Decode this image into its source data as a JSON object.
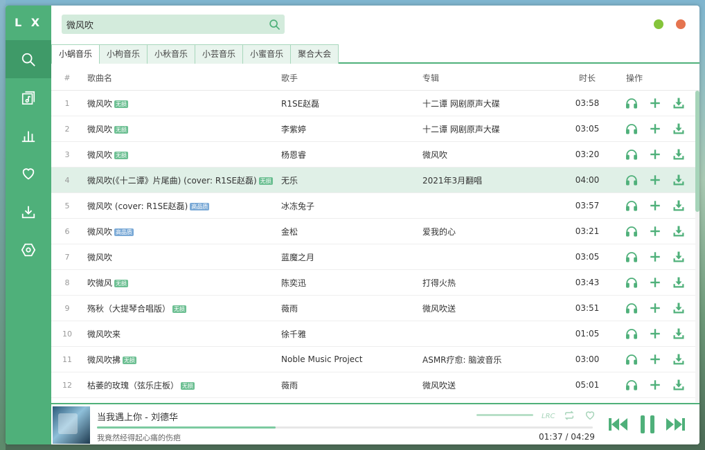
{
  "app": {
    "logo": "L X"
  },
  "search": {
    "value": "微风吹"
  },
  "tabs": [
    "小蜗音乐",
    "小枸音乐",
    "小秋音乐",
    "小芸音乐",
    "小蜜音乐",
    "聚合大会"
  ],
  "table": {
    "headers": {
      "num": "#",
      "name": "歌曲名",
      "artist": "歌手",
      "album": "专辑",
      "duration": "时长",
      "ops": "操作"
    },
    "rows": [
      {
        "num": "1",
        "name": "微风吹",
        "tag": "无损",
        "tag_type": "sq",
        "artist": "R1SE赵磊",
        "album": "十二谭 网剧原声大碟",
        "duration": "03:58"
      },
      {
        "num": "2",
        "name": "微风吹",
        "tag": "无损",
        "tag_type": "sq",
        "artist": "李紫婷",
        "album": "十二谭 网剧原声大碟",
        "duration": "03:05"
      },
      {
        "num": "3",
        "name": "微风吹",
        "tag": "无损",
        "tag_type": "sq",
        "artist": "杨恩睿",
        "album": "微风吹",
        "duration": "03:20"
      },
      {
        "num": "4",
        "name": "微风吹(《十二谭》片尾曲) (cover: R1SE赵磊)",
        "tag": "无损",
        "tag_type": "sq",
        "artist": "无乐",
        "album": "2021年3月翻唱",
        "duration": "04:00"
      },
      {
        "num": "5",
        "name": "微风吹 (cover: R1SE赵磊)",
        "tag": "高品质",
        "tag_type": "hq",
        "artist": "冰冻兔子",
        "album": "",
        "duration": "03:57"
      },
      {
        "num": "6",
        "name": "微风吹",
        "tag": "高品质",
        "tag_type": "hq",
        "artist": "金松",
        "album": "爱我的心",
        "duration": "03:21"
      },
      {
        "num": "7",
        "name": "微风吹",
        "tag": "",
        "tag_type": "",
        "artist": "蓝魔之月",
        "album": "",
        "duration": "03:05"
      },
      {
        "num": "8",
        "name": "吹微风",
        "tag": "无损",
        "tag_type": "sq",
        "artist": "陈奕迅",
        "album": "打得火热",
        "duration": "03:43"
      },
      {
        "num": "9",
        "name": "殇秋（大提琴合唱版）",
        "tag": "无损",
        "tag_type": "sq",
        "artist": "薇雨",
        "album": "微风吹送",
        "duration": "03:51"
      },
      {
        "num": "10",
        "name": "微风吹来",
        "tag": "",
        "tag_type": "",
        "artist": "徐千雅",
        "album": "",
        "duration": "01:05"
      },
      {
        "num": "11",
        "name": "微风吹拂",
        "tag": "无损",
        "tag_type": "sq",
        "artist": "Noble Music Project",
        "album": "ASMR疗愈: 脑波音乐",
        "duration": "03:00"
      },
      {
        "num": "12",
        "name": "枯萎的玫瑰（弦乐庄板）",
        "tag": "无损",
        "tag_type": "sq",
        "artist": "薇雨",
        "album": "微风吹送",
        "duration": "05:01"
      }
    ],
    "highlighted_row": 4,
    "row_icons": [
      "headphones-icon",
      "plus-icon",
      "download-icon"
    ]
  },
  "player": {
    "title": "当我遇上你 - 刘德华",
    "lyric": "我竟然经得起心痛的伤疤",
    "current_time": "01:37",
    "separator": "/",
    "total_time": "04:29",
    "progress_percent": 36,
    "lrc_label": "LRC"
  },
  "colors": {
    "accent": "#4fb07a",
    "accent_dark": "#3f9a68",
    "highlight": "#e0f0e7",
    "min": "#85c43a",
    "close": "#e5744f"
  }
}
